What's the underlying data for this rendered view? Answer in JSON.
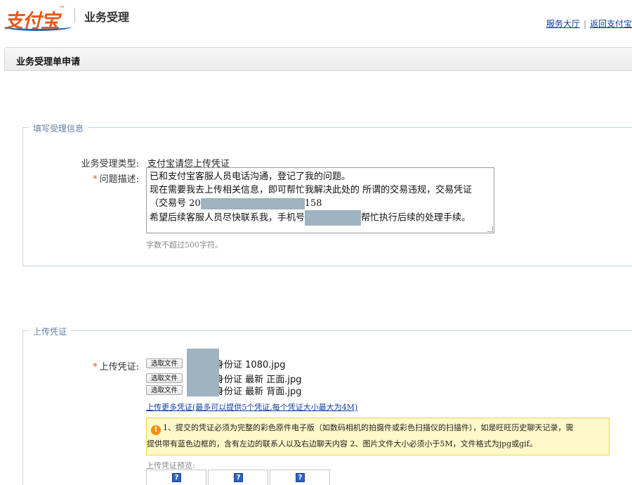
{
  "header": {
    "logo_text": "支付宝",
    "logo_tm": "™",
    "section_title": "业务受理",
    "links": [
      "服务大厅",
      "返回支付宝"
    ]
  },
  "title_bar": "业务受理单申请",
  "fill_section": {
    "legend": "填写受理信息",
    "type_label": "业务受理类型:",
    "type_value": "支付宝请您上传凭证",
    "desc_required": "*",
    "desc_label": "问题描述:",
    "desc_lines": {
      "l1": "已和支付宝客服人员电话沟通，登记了我的问题。",
      "l2": "现在需要我去上传相关信息，即可帮忙我解决此处的 所谓的交易违规，交易凭证",
      "l3_a": "（交易号 20",
      "l3_b": "158",
      "l4_a": "希望后续客服人员尽快联系我，手机号",
      "l4_b": "帮忙执行后续的处理手续。"
    },
    "hint": "字数不超过500字符。"
  },
  "upload_section": {
    "legend": "上传凭证",
    "label_required": "*",
    "label": "上传凭证:",
    "choose_file_label": "选取文件",
    "files": [
      "身份证 1080.jpg",
      "身份证 最新 正面.jpg",
      "身份证 最新 背面.jpg"
    ],
    "more_link": "上传更多凭证(最多可以提供5个凭证,每个凭证大小最大为4M)",
    "notice_icon": "!",
    "notice_line1": "1、提交的凭证必须为完整的彩色原件电子版（如数码相机的拍摄件或彩色扫描仪的扫描件），如是旺旺历史聊天记录，需",
    "notice_line2": "提供带有蓝色边框的，含有左边的联系人以及右边聊天内容 2、图片文件大小必须小于5M，文件格式为jpg或gif。",
    "preview_label": "上传凭证预览:",
    "preview_placeholder": "?"
  },
  "colors": {
    "brand_orange": "#e8581a",
    "brand_blue": "#1a6bb8",
    "link": "#0a3f9f",
    "redaction": "#9fb3c0",
    "notice_bg": "#fff8c8"
  }
}
